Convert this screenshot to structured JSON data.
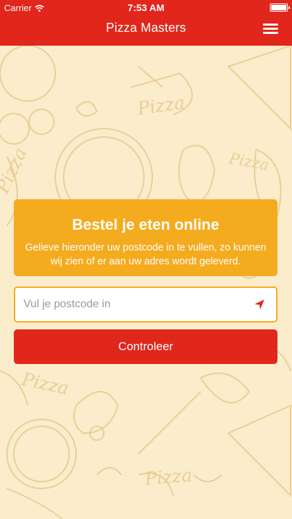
{
  "status_bar": {
    "carrier": "Carrier",
    "time": "7:53 AM"
  },
  "nav": {
    "title": "Pizza Masters",
    "menu_icon": "hamburger-menu-icon"
  },
  "background": {
    "doodle_words": [
      "Pizza",
      "Pizza",
      "Pizza",
      "Pizza",
      "Pizza"
    ]
  },
  "order_card": {
    "title": "Bestel je eten online",
    "description": "Gelieve hieronder uw postcode in te vullen, zo kunnen wij zien of er aan uw adres wordt geleverd."
  },
  "postcode": {
    "placeholder": "Vul je postcode in",
    "value": "",
    "location_icon": "location-arrow-icon"
  },
  "submit": {
    "label": "Controleer"
  },
  "colors": {
    "primary_red": "#e1261c",
    "accent_orange": "#f5ab1e",
    "background": "#fbeccb"
  }
}
